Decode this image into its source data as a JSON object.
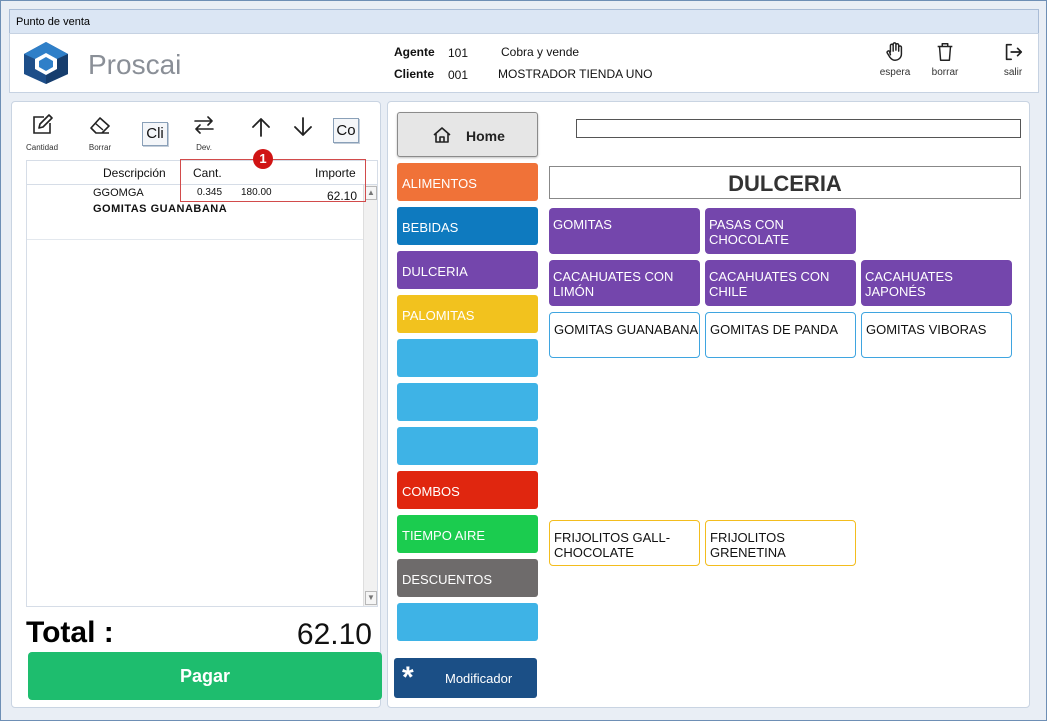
{
  "window": {
    "title": "Punto de venta"
  },
  "header": {
    "logo_text": "Proscai",
    "agente_label": "Agente",
    "agente_id": "101",
    "agente_desc": "Cobra y vende",
    "cliente_label": "Cliente",
    "cliente_id": "001",
    "cliente_desc": "MOSTRADOR TIENDA UNO",
    "actions": [
      {
        "label": "espera",
        "icon": "hand-icon"
      },
      {
        "label": "borrar",
        "icon": "trash-icon"
      },
      {
        "label": "salir",
        "icon": "exit-icon"
      }
    ]
  },
  "toolbar": {
    "cantidad_label": "Cantidad",
    "borrar_label": "Borrar",
    "cli_label": "Cli",
    "dev_label": "Dev.",
    "co_label": "Co"
  },
  "ticket": {
    "columns": {
      "descripcion": "Descripción",
      "cant": "Cant.",
      "importe": "Importe"
    },
    "rows": [
      {
        "code": "GGOMGA",
        "qty": "0.345",
        "price": "180.00",
        "importe": "62.10",
        "description": "GOMITAS GUANABANA"
      }
    ],
    "annotation_badge": "1"
  },
  "totals": {
    "label": "Total :",
    "value": "62.10",
    "pay_label": "Pagar"
  },
  "nav": {
    "home_label": "Home",
    "search_value": "",
    "categories": [
      {
        "label": "ALIMENTOS",
        "color": "#f07238"
      },
      {
        "label": "BEBIDAS",
        "color": "#0e7abf"
      },
      {
        "label": "DULCERIA",
        "color": "#7446ac"
      },
      {
        "label": "PALOMITAS",
        "color": "#f2c21e"
      },
      {
        "label": "",
        "color": "#3eb3e6"
      },
      {
        "label": "",
        "color": "#3eb3e6"
      },
      {
        "label": "",
        "color": "#3eb3e6"
      },
      {
        "label": "COMBOS",
        "color": "#e0260f"
      },
      {
        "label": "TIEMPO AIRE",
        "color": "#1bcc4f"
      },
      {
        "label": "DESCUENTOS",
        "color": "#6e6b6b"
      },
      {
        "label": "",
        "color": "#3eb3e6"
      }
    ],
    "modifier_label": "Modificador"
  },
  "catalog": {
    "title": "DULCERIA",
    "products": [
      {
        "label": "GOMITAS",
        "style": "solid"
      },
      {
        "label": "PASAS CON CHOCOLATE",
        "style": "solid"
      },
      {
        "label": "CACAHUATES CON LIMÓN",
        "style": "solid"
      },
      {
        "label": "CACAHUATES CON CHILE",
        "style": "solid"
      },
      {
        "label": "CACAHUATES JAPONÉS",
        "style": "solid"
      },
      {
        "label": "GOMITAS GUANABANA",
        "style": "blue"
      },
      {
        "label": "GOMITAS DE PANDA",
        "style": "blue"
      },
      {
        "label": "GOMITAS VIBORAS",
        "style": "blue"
      },
      {
        "label": "FRIJOLITOS GALL-CHOCOLATE",
        "style": "yellow"
      },
      {
        "label": "FRIJOLITOS GRENETINA",
        "style": "yellow"
      }
    ]
  }
}
